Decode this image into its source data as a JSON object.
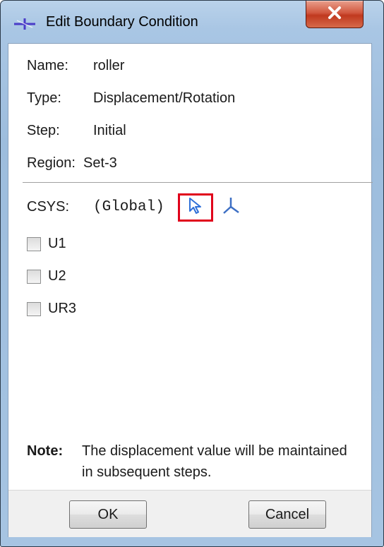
{
  "window": {
    "title": "Edit Boundary Condition",
    "accent": "#e0001b",
    "close_glyph": "✕"
  },
  "fields": [
    {
      "label": "Name:",
      "value": "roller"
    },
    {
      "label": "Type:",
      "value": "Displacement/Rotation"
    },
    {
      "label": "Step:",
      "value": "Initial"
    },
    {
      "label": "Region:",
      "value": "Set-3"
    }
  ],
  "csys": {
    "label": "CSYS:",
    "value": "(Global)",
    "select_icon": "arrow-cursor-icon",
    "datum_icon": "csys-triad-icon"
  },
  "checkboxes": [
    {
      "label": "U1",
      "checked": false
    },
    {
      "label": "U2",
      "checked": false
    },
    {
      "label": "UR3",
      "checked": false
    }
  ],
  "note": {
    "label": "Note:",
    "text": "The displacement value will be maintained in subsequent steps."
  },
  "buttons": {
    "ok": "OK",
    "cancel": "Cancel"
  }
}
